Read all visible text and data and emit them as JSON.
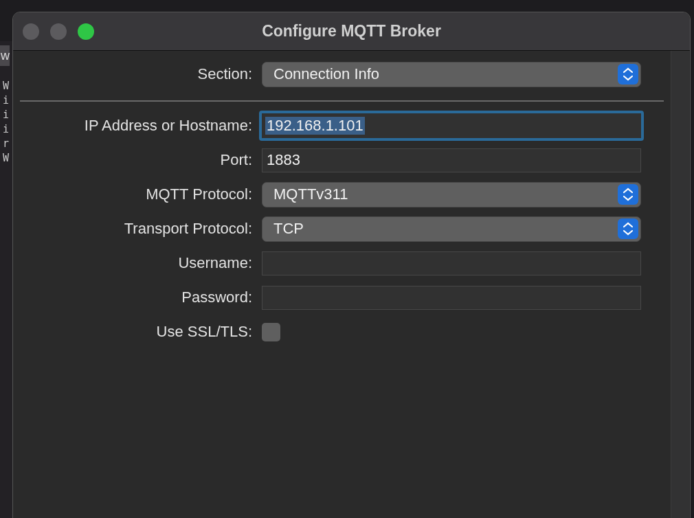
{
  "background_window": {
    "button": "w",
    "log_lines": [
      "W",
      "i",
      "i",
      "i",
      "r",
      "W"
    ]
  },
  "window": {
    "title": "Configure MQTT Broker"
  },
  "section": {
    "label": "Section:",
    "value": "Connection Info"
  },
  "fields": [
    {
      "kind": "text",
      "label": "IP Address or Hostname:",
      "value": "192.168.1.101",
      "focused": true
    },
    {
      "kind": "text",
      "label": "Port:",
      "value": "1883",
      "focused": false
    },
    {
      "kind": "popup",
      "label": "MQTT Protocol:",
      "value": "MQTTv311"
    },
    {
      "kind": "popup",
      "label": "Transport Protocol:",
      "value": "TCP"
    },
    {
      "kind": "text",
      "label": "Username:",
      "focused": false
    },
    {
      "kind": "text",
      "label": "Password:",
      "focused": false
    },
    {
      "kind": "checkbox",
      "label": "Use SSL/TLS:",
      "checked": false
    }
  ]
}
